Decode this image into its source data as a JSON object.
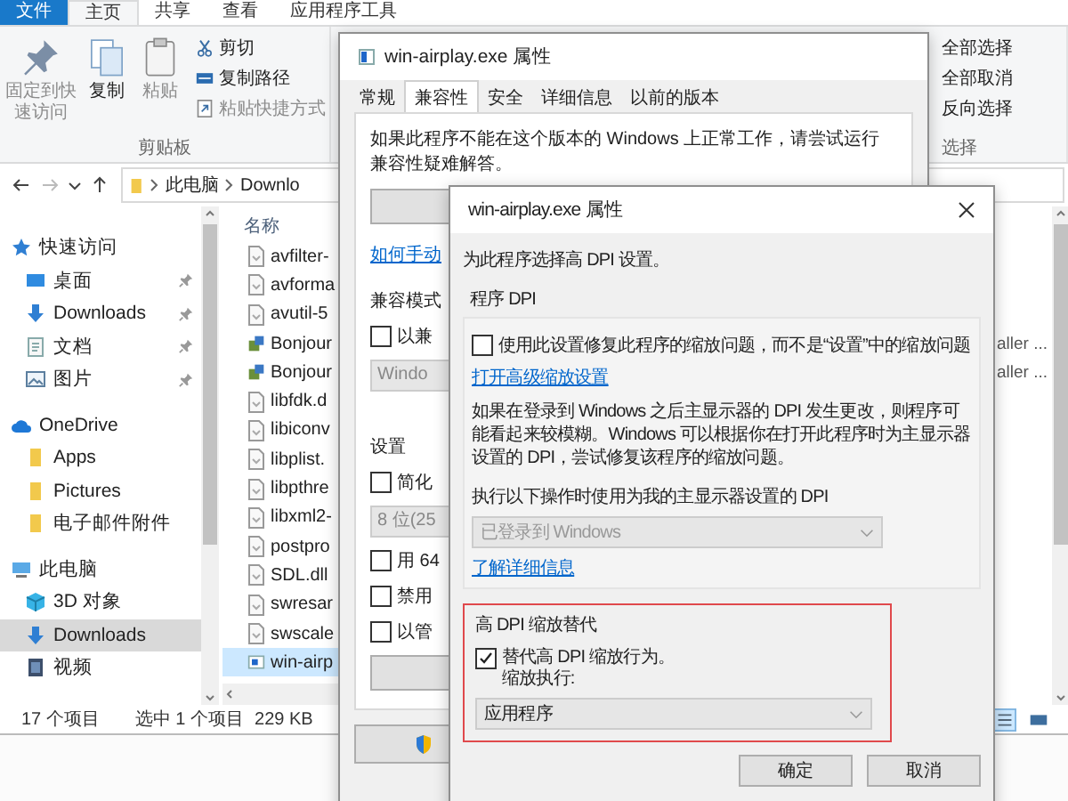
{
  "explorer": {
    "ribbon_tabs": [
      {
        "label": "文件",
        "kind": "file",
        "selected": false
      },
      {
        "label": "主页",
        "kind": "tab",
        "selected": true
      },
      {
        "label": "共享",
        "kind": "tab",
        "selected": false
      },
      {
        "label": "查看",
        "kind": "tab",
        "selected": false
      },
      {
        "label": "应用程序工具",
        "kind": "tab",
        "selected": false
      }
    ],
    "clipboard": {
      "large_buttons": [
        {
          "label": "固定到快速访问",
          "kind": "pin",
          "disabled": true
        },
        {
          "label": "复制",
          "kind": "copy",
          "disabled": false
        },
        {
          "label": "粘贴",
          "kind": "paste",
          "disabled": true
        }
      ],
      "small_buttons": [
        {
          "label": "剪切",
          "kind": "cut",
          "disabled": false
        },
        {
          "label": "复制路径",
          "kind": "copy-path",
          "disabled": false
        },
        {
          "label": "粘贴快捷方式",
          "kind": "paste-shortcut",
          "disabled": true
        }
      ],
      "group_label": "剪贴板"
    },
    "select_group": {
      "items": [
        "全部选择",
        "全部取消",
        "反向选择"
      ],
      "group_label": "选择"
    },
    "address": {
      "path": [
        "此电脑",
        "Downlo"
      ]
    },
    "nav": [
      {
        "label": "快速访问",
        "kind": "star",
        "selected": false,
        "children": [
          {
            "label": "桌面",
            "kind": "desktop",
            "pinned": true,
            "selected": false
          },
          {
            "label": "Downloads",
            "kind": "download",
            "pinned": true,
            "selected": false
          },
          {
            "label": "文档",
            "kind": "document",
            "pinned": true,
            "selected": false
          },
          {
            "label": "图片",
            "kind": "picture",
            "pinned": true,
            "selected": false
          }
        ]
      },
      {
        "label": "OneDrive",
        "kind": "cloud",
        "selected": false,
        "children": [
          {
            "label": "Apps",
            "kind": "folder",
            "pinned": false,
            "selected": false
          },
          {
            "label": "Pictures",
            "kind": "folder",
            "pinned": false,
            "selected": false
          },
          {
            "label": "电子邮件附件",
            "kind": "folder",
            "pinned": false,
            "selected": false
          }
        ]
      },
      {
        "label": "此电脑",
        "kind": "computer",
        "selected": false,
        "children": [
          {
            "label": "3D 对象",
            "kind": "cube",
            "pinned": false,
            "selected": false
          },
          {
            "label": "Downloads",
            "kind": "download",
            "pinned": false,
            "selected": true
          },
          {
            "label": "视频",
            "kind": "video",
            "pinned": false,
            "selected": false
          }
        ]
      }
    ],
    "file_list": {
      "column": "名称",
      "files": [
        {
          "name": "avfilter-",
          "kind": "dll",
          "selected": false
        },
        {
          "name": "avforma",
          "kind": "dll",
          "selected": false
        },
        {
          "name": "avutil-5",
          "kind": "dll",
          "selected": false
        },
        {
          "name": "Bonjour",
          "kind": "setup",
          "selected": false,
          "type": "aller ..."
        },
        {
          "name": "Bonjour",
          "kind": "setup",
          "selected": false,
          "type": "aller ..."
        },
        {
          "name": "libfdk.d",
          "kind": "dll",
          "selected": false
        },
        {
          "name": "libiconv",
          "kind": "dll",
          "selected": false
        },
        {
          "name": "libplist.",
          "kind": "dll",
          "selected": false
        },
        {
          "name": "libpthre",
          "kind": "dll",
          "selected": false
        },
        {
          "name": "libxml2-",
          "kind": "dll",
          "selected": false
        },
        {
          "name": "postpro",
          "kind": "dll",
          "selected": false
        },
        {
          "name": "SDL.dll",
          "kind": "dll",
          "selected": false
        },
        {
          "name": "swresar",
          "kind": "dll",
          "selected": false
        },
        {
          "name": "swscale",
          "kind": "dll",
          "selected": false
        },
        {
          "name": "win-airp",
          "kind": "exe",
          "selected": true
        }
      ]
    },
    "status_bar": {
      "count": "17 个项目",
      "selection": "选中 1 个项目",
      "size": "229 KB"
    },
    "views": [
      {
        "kind": "details",
        "selected": true
      },
      {
        "kind": "large-icons",
        "selected": false
      }
    ]
  },
  "properties": {
    "title": "win-airplay.exe 属性",
    "tabs": [
      {
        "label": "常规",
        "selected": false
      },
      {
        "label": "兼容性",
        "selected": true
      },
      {
        "label": "安全",
        "selected": false
      },
      {
        "label": "详细信息",
        "selected": false
      },
      {
        "label": "以前的版本",
        "selected": false
      }
    ],
    "intro": "如果此程序不能在这个版本的 Windows 上正常工作，请尝试运行兼容性疑难解答。",
    "help_link": "如何手动",
    "compat_label": "兼容模式",
    "compat_check": {
      "label": "以兼",
      "checked": false
    },
    "compat_select": "Windo",
    "settings_label": "设置",
    "settings": [
      {
        "kind": "check",
        "label": "简化",
        "checked": false
      },
      {
        "kind": "select",
        "value": "8 位(25"
      },
      {
        "kind": "check",
        "label": "用 64",
        "checked": false
      },
      {
        "kind": "check",
        "label": "禁用",
        "checked": false
      },
      {
        "kind": "check",
        "label": "以管",
        "checked": false
      }
    ]
  },
  "dpi": {
    "title": "win-airplay.exe 属性",
    "heading": "为此程序选择高 DPI 设置。",
    "program_dpi": {
      "label": "程序 DPI",
      "check": {
        "label": "使用此设置修复此程序的缩放问题，而不是“设置”中的缩放问题",
        "checked": false
      },
      "link": "打开高级缩放设置",
      "description": "如果在登录到 Windows 之后主显示器的 DPI 发生更改，则程序可能看起来较模糊。Windows 可以根据你在打开此程序时为主显示器设置的 DPI，尝试修复该程序的缩放问题。",
      "when_label": "执行以下操作时使用为我的主显示器设置的 DPI",
      "when_select": {
        "value": "已登录到 Windows",
        "disabled": true
      },
      "more_link": "了解详细信息"
    },
    "override": {
      "label": "高 DPI 缩放替代",
      "check": {
        "label": "替代高 DPI 缩放行为。",
        "checked": true
      },
      "sub_label": "缩放执行:",
      "select": {
        "value": "应用程序",
        "disabled": false
      }
    },
    "buttons": [
      "确定",
      "取消"
    ]
  }
}
